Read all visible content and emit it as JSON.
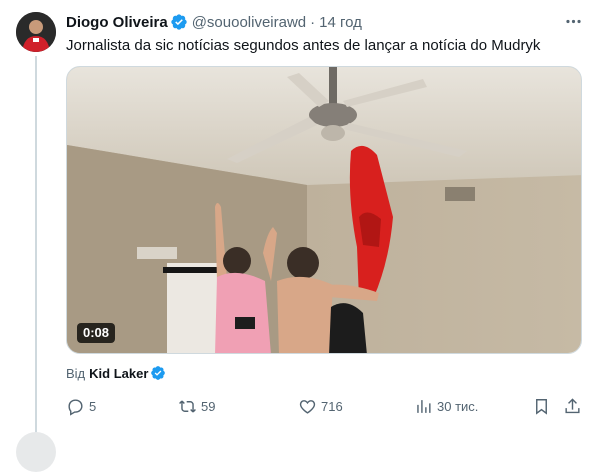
{
  "tweet": {
    "author_name": "Diogo Oliveira",
    "author_handle": "@souooliveirawd",
    "separator": "·",
    "time": "14 год",
    "text": "Jornalista da sic notícias segundos antes de lançar a notícia do Mudryk",
    "video_duration": "0:08",
    "credit_label": "Від",
    "credit_name": "Kid Laker"
  },
  "actions": {
    "reply_count": "5",
    "retweet_count": "59",
    "like_count": "716",
    "views_count": "30 тис."
  },
  "colors": {
    "verified": "#1d9bf0",
    "secondary_text": "#536471",
    "thread_line": "#cfd9de"
  },
  "icons": [
    "verified-badge-icon",
    "more-icon",
    "reply-icon",
    "retweet-icon",
    "like-icon",
    "views-icon",
    "bookmark-icon",
    "share-icon"
  ]
}
